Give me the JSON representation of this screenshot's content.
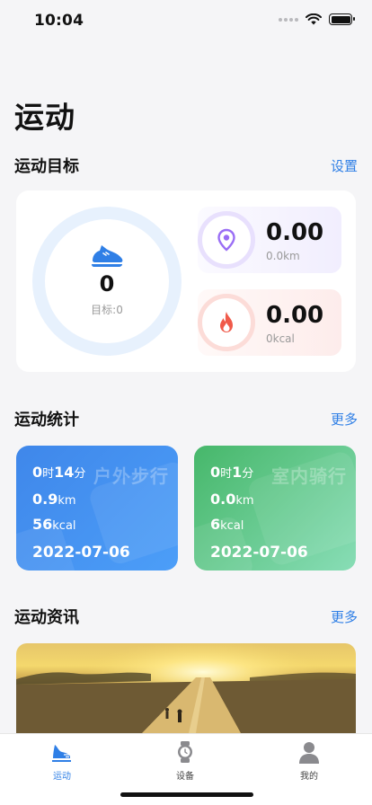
{
  "status_bar": {
    "time": "10:04"
  },
  "page_title": "运动",
  "goal_section": {
    "title": "运动目标",
    "action": "设置",
    "ring": {
      "value": "0",
      "target_label": "目标:0",
      "progress": 0
    },
    "distance": {
      "value": "0.00",
      "unit_text": "0.0km",
      "icon": "location-pin-icon"
    },
    "calories": {
      "value": "0.00",
      "unit_text": "0kcal",
      "icon": "flame-icon"
    }
  },
  "stats_section": {
    "title": "运动统计",
    "action": "更多",
    "cards": [
      {
        "title": "户外步行",
        "hours": "0",
        "hours_unit": "时",
        "minutes": "14",
        "minutes_unit": "分",
        "distance": "0.9",
        "distance_unit": "km",
        "calories": "56",
        "calories_unit": "kcal",
        "date": "2022-07-06",
        "color": "#4390f0"
      },
      {
        "title": "室内骑行",
        "hours": "0",
        "hours_unit": "时",
        "minutes": "1",
        "minutes_unit": "分",
        "distance": "0.0",
        "distance_unit": "km",
        "calories": "6",
        "calories_unit": "kcal",
        "date": "2022-07-06",
        "color": "#5cc680"
      }
    ]
  },
  "news_section": {
    "title": "运动资讯",
    "action": "更多"
  },
  "tab_bar": {
    "items": [
      {
        "label": "运动",
        "icon": "running-shoe-icon",
        "active": true
      },
      {
        "label": "设备",
        "icon": "watch-icon",
        "active": false
      },
      {
        "label": "我的",
        "icon": "person-icon",
        "active": false
      }
    ]
  },
  "colors": {
    "accent": "#2f7fe6",
    "ring": "#e7f1fd",
    "pin": "#9a6ef5",
    "flame": "#f05a4a"
  }
}
